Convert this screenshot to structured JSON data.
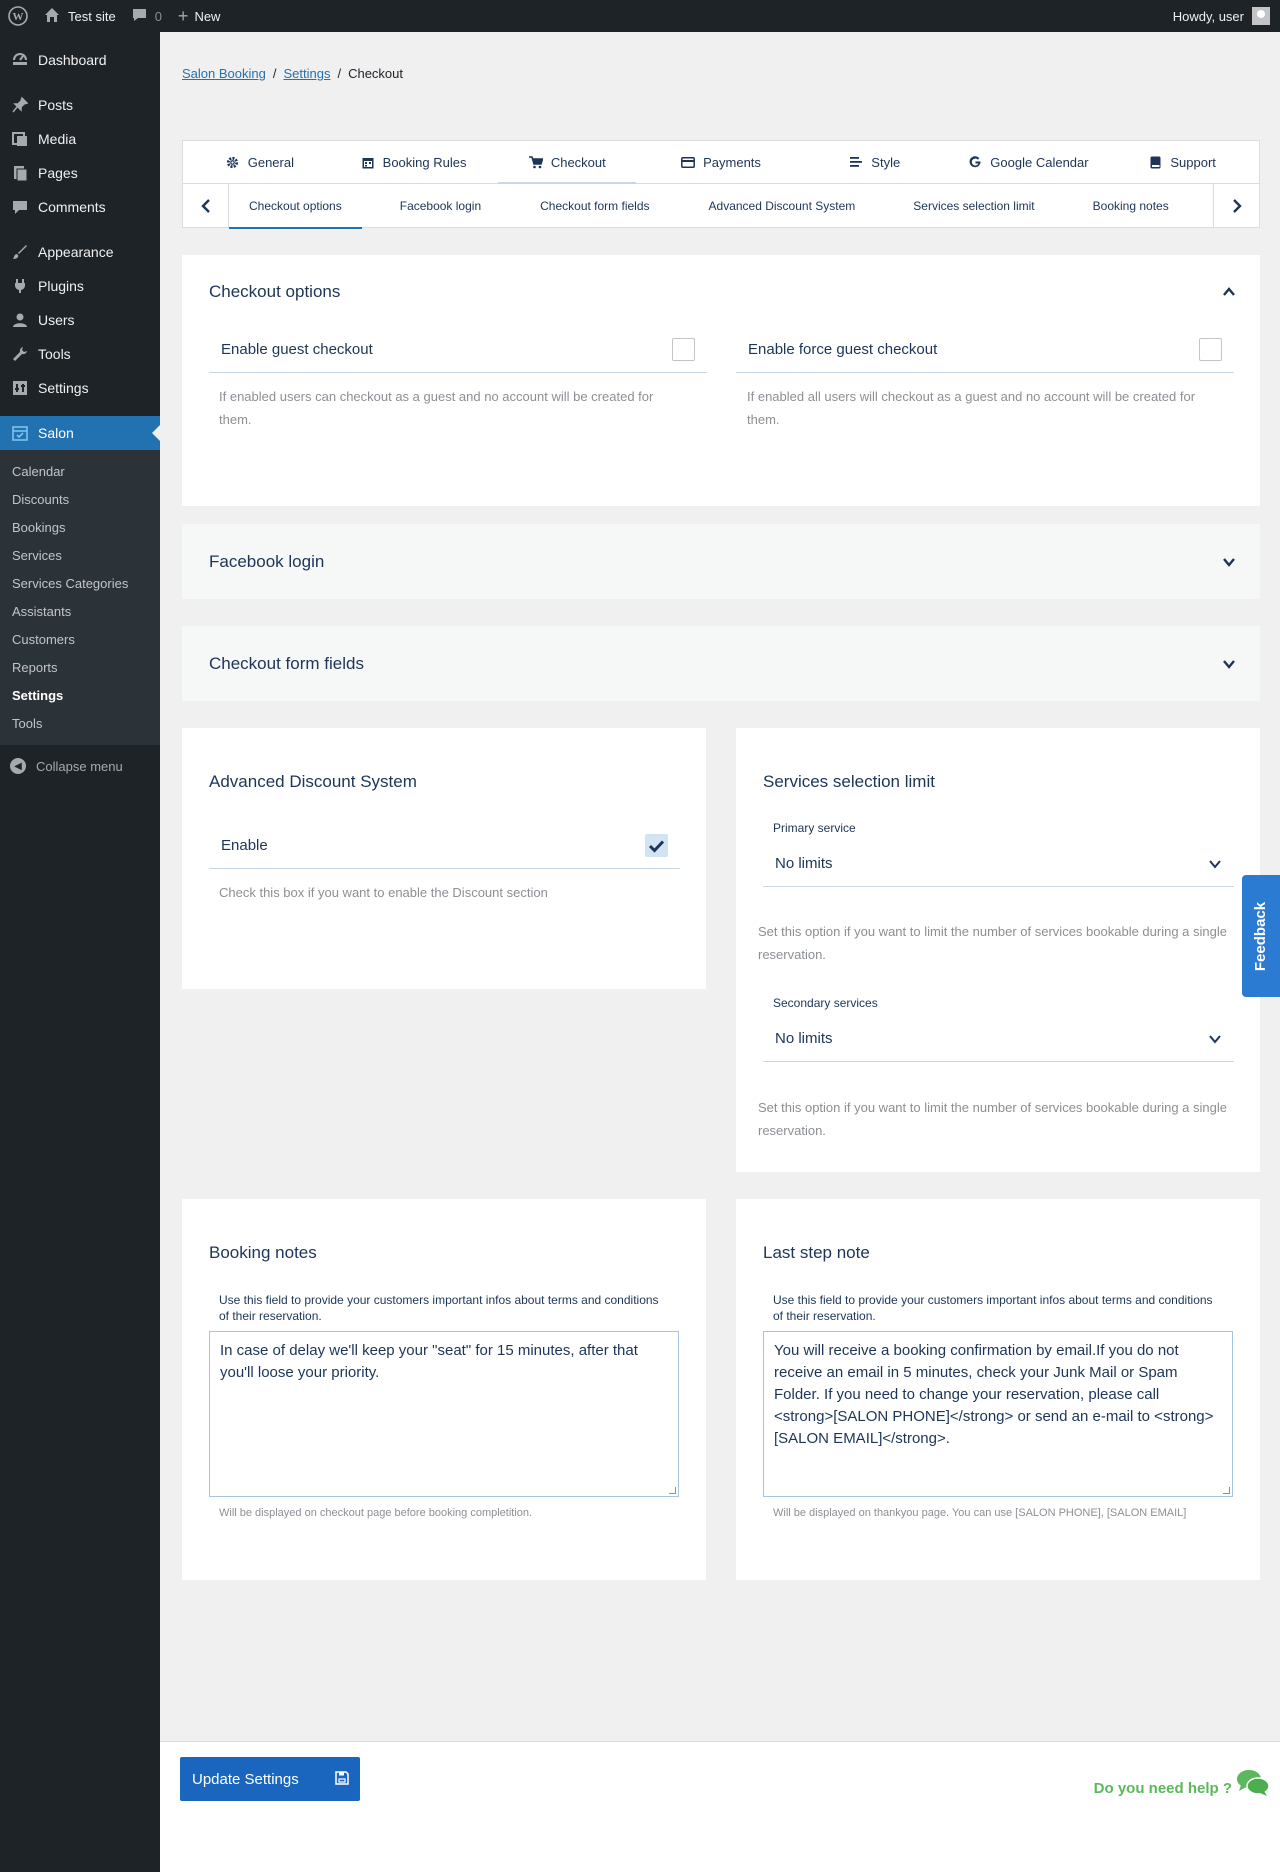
{
  "adminbar": {
    "site_name": "Test site",
    "comments_count": "0",
    "new_label": "New",
    "howdy": "Howdy, user"
  },
  "sidebar": {
    "items": [
      {
        "label": "Dashboard",
        "icon": "dashboard-icon"
      },
      {
        "label": "Posts",
        "icon": "pin-icon"
      },
      {
        "label": "Media",
        "icon": "media-icon"
      },
      {
        "label": "Pages",
        "icon": "page-icon"
      },
      {
        "label": "Comments",
        "icon": "comment-icon"
      },
      {
        "label": "Appearance",
        "icon": "brush-icon"
      },
      {
        "label": "Plugins",
        "icon": "plug-icon"
      },
      {
        "label": "Users",
        "icon": "user-icon"
      },
      {
        "label": "Tools",
        "icon": "wrench-icon"
      },
      {
        "label": "Settings",
        "icon": "settings-icon"
      },
      {
        "label": "Salon",
        "icon": "calendar-icon"
      }
    ],
    "submenu": [
      "Calendar",
      "Discounts",
      "Bookings",
      "Services",
      "Services Categories",
      "Assistants",
      "Customers",
      "Reports",
      "Settings",
      "Tools"
    ],
    "collapse_label": "Collapse menu"
  },
  "breadcrumb": {
    "root": "Salon Booking",
    "settings": "Settings",
    "current": "Checkout"
  },
  "tabs": [
    "General",
    "Booking Rules",
    "Checkout",
    "Payments",
    "Style",
    "Google Calendar",
    "Support"
  ],
  "subtabs": [
    "Checkout options",
    "Facebook login",
    "Checkout form fields",
    "Advanced Discount System",
    "Services selection limit",
    "Booking notes"
  ],
  "checkout_options": {
    "title": "Checkout options",
    "guest_label": "Enable guest checkout",
    "guest_help": "If enabled users can checkout as a guest and no account will be created for them.",
    "force_label": "Enable force guest checkout",
    "force_help": "If enabled all users will checkout as a guest and no account will be created for them."
  },
  "facebook": {
    "title": "Facebook login"
  },
  "form_fields": {
    "title": "Checkout form fields"
  },
  "discount": {
    "title": "Advanced Discount System",
    "enable_label": "Enable",
    "enabled": true,
    "help": "Check this box if you want to enable the Discount section"
  },
  "limits": {
    "title": "Services selection limit",
    "primary_label": "Primary service",
    "primary_value": "No limits",
    "primary_help": "Set this option if you want to limit the number of services bookable during a single reservation.",
    "secondary_label": "Secondary services",
    "secondary_value": "No limits",
    "secondary_help": "Set this option if you want to limit the number of services bookable during a single reservation."
  },
  "booking_notes": {
    "title": "Booking notes",
    "label": "Use this field to provide your customers important infos about terms and conditions of their reservation.",
    "value": "In case of delay we'll keep your \"seat\" for 15 minutes, after that you'll loose your priority.",
    "help": "Will be displayed on checkout page before booking completition."
  },
  "last_step": {
    "title": "Last step note",
    "label": "Use this field to provide your customers important infos about terms and conditions of their reservation.",
    "value": "You will receive a booking confirmation by email.If you do not receive an email in 5 minutes, check your Junk Mail or Spam Folder. If you need to change your reservation, please call <strong>[SALON PHONE]</strong> or send an e-mail to <strong>[SALON EMAIL]</strong>.",
    "help": "Will be displayed on thankyou page. You can use [SALON PHONE], [SALON EMAIL]"
  },
  "feedback_label": "Feedback",
  "footer": {
    "update_label": "Update Settings",
    "help_label": "Do you need help ?"
  },
  "colors": {
    "accent": "#2271b1",
    "primary_button": "#1a66bf",
    "help_green": "#5cb85c",
    "feedback_blue": "#2b7bd3"
  }
}
